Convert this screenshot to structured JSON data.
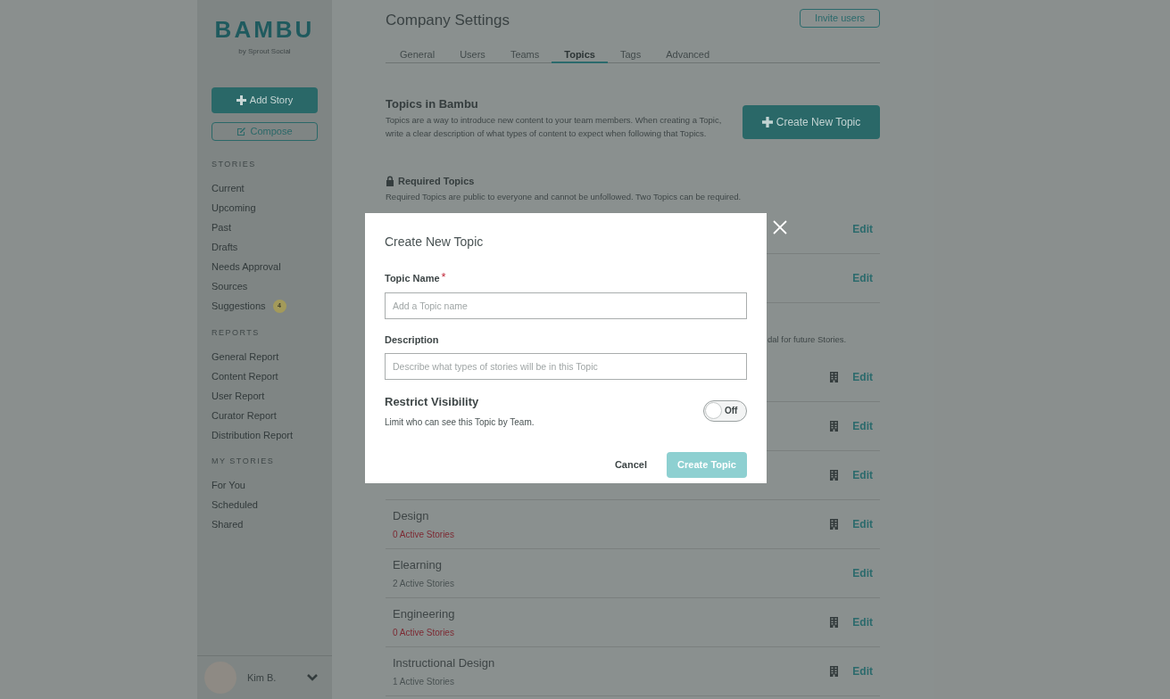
{
  "sidebar": {
    "logo": "BAMBU",
    "logo_sub": "by Sprout Social",
    "add_story": "Add Story",
    "compose": "Compose",
    "sections": [
      {
        "title": "STORIES",
        "items": [
          {
            "label": "Current"
          },
          {
            "label": "Upcoming"
          },
          {
            "label": "Past"
          },
          {
            "label": "Drafts"
          },
          {
            "label": "Needs Approval"
          },
          {
            "label": "Sources"
          },
          {
            "label": "Suggestions",
            "badge": "4"
          }
        ]
      },
      {
        "title": "REPORTS",
        "items": [
          {
            "label": "General Report"
          },
          {
            "label": "Content Report"
          },
          {
            "label": "User Report"
          },
          {
            "label": "Curator Report"
          },
          {
            "label": "Distribution Report"
          }
        ]
      },
      {
        "title": "MY STORIES",
        "items": [
          {
            "label": "For You"
          },
          {
            "label": "Scheduled"
          },
          {
            "label": "Shared"
          }
        ]
      }
    ],
    "user": {
      "name": "Kim B."
    }
  },
  "header": {
    "title": "Company Settings",
    "invite": "Invite users"
  },
  "tabs": [
    {
      "label": "General",
      "selected": false
    },
    {
      "label": "Users",
      "selected": false
    },
    {
      "label": "Teams",
      "selected": false
    },
    {
      "label": "Topics",
      "selected": true
    },
    {
      "label": "Tags",
      "selected": false
    },
    {
      "label": "Advanced",
      "selected": false
    }
  ],
  "intro": {
    "title": "Topics in Bambu",
    "text": "Topics are a way to introduce new content to your team members. When creating a Topic, write a clear description of what types of content to expect when following that Topics.",
    "create": "Create New Topic"
  },
  "required": {
    "title": "Required Topics",
    "text": "Required Topics are public to everyone and cannot be unfollowed. Two Topics can be required."
  },
  "required_rows": [
    {
      "restricted": false,
      "edit": "Edit"
    },
    {
      "restricted": false,
      "edit": "Edit"
    }
  ],
  "optional_fragment": "dal for future Stories.",
  "rows": [
    {
      "restricted": true,
      "edit": "Edit"
    },
    {
      "restricted": true,
      "edit": "Edit"
    },
    {
      "restricted": true,
      "edit": "Edit"
    },
    {
      "name": "Design",
      "count": "0 Active Stories",
      "warning": true,
      "restricted": true,
      "edit": "Edit"
    },
    {
      "name": "Elearning",
      "count": "2 Active Stories",
      "warning": false,
      "restricted": false,
      "edit": "Edit"
    },
    {
      "name": "Engineering",
      "count": "0 Active Stories",
      "warning": true,
      "restricted": true,
      "edit": "Edit"
    },
    {
      "name": "Instructional Design",
      "count": "1 Active Stories",
      "warning": false,
      "restricted": true,
      "edit": "Edit"
    }
  ],
  "modal": {
    "title": "Create New Topic",
    "name_label": "Topic Name",
    "name_required": true,
    "required_mark": "*",
    "name_placeholder": "Add a Topic name",
    "desc_label": "Description",
    "desc_placeholder": "Describe what types of stories will be in this Topic",
    "restrict_title": "Restrict Visibility",
    "restrict_text": "Limit who can see this Topic by Team.",
    "toggle": {
      "on": false,
      "label": "Off"
    },
    "cancel": "Cancel",
    "submit": "Create Topic"
  }
}
